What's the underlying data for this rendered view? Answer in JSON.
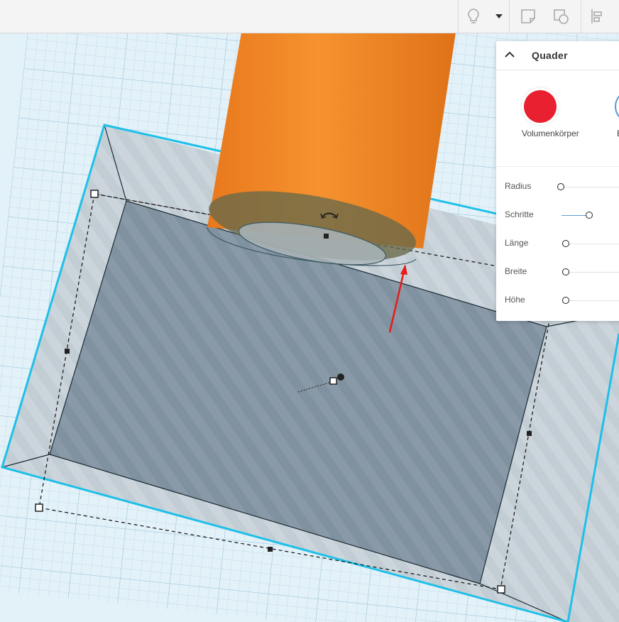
{
  "toolbar": {
    "icons": [
      "lightbulb-icon",
      "dropdown-arrow-icon",
      "note-icon",
      "ruler-icon",
      "align-icon"
    ]
  },
  "inspector": {
    "title": "Quader",
    "solid_label": "Volumenkörper",
    "hole_label": "B",
    "solid_color": "#e8202f",
    "properties": [
      {
        "label": "Radius",
        "value": 0.0
      },
      {
        "label": "Schritte",
        "value": 0.42
      },
      {
        "label": "Länge",
        "value": 0.0
      },
      {
        "label": "Breite",
        "value": 0.0
      },
      {
        "label": "Höhe",
        "value": 0.0
      }
    ]
  },
  "colors": {
    "cylinder": "#f08a2c",
    "selection_outline": "#1ec0e8",
    "annotation_arrow": "#e81a1a"
  }
}
